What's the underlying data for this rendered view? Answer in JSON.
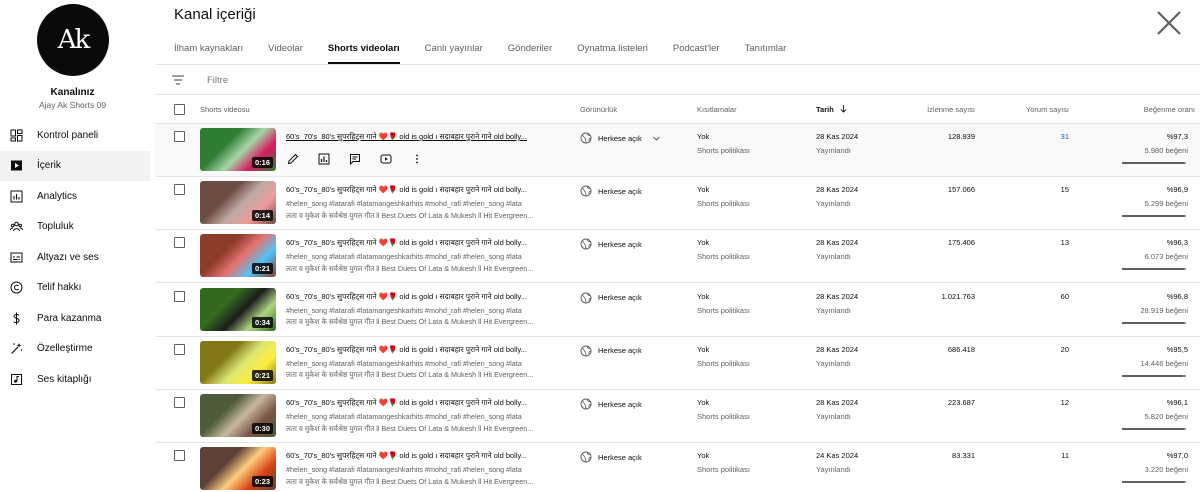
{
  "channel": {
    "avatar_text": "Ak",
    "title": "Kanalınız",
    "name": "Ajay Ak Shorts 09"
  },
  "nav": [
    {
      "label": "Kontrol paneli",
      "icon": "dashboard-icon"
    },
    {
      "label": "İçerik",
      "icon": "content-icon",
      "active": true
    },
    {
      "label": "Analytics",
      "icon": "analytics-icon"
    },
    {
      "label": "Topluluk",
      "icon": "community-icon"
    },
    {
      "label": "Altyazı ve ses",
      "icon": "subtitles-icon"
    },
    {
      "label": "Telif hakkı",
      "icon": "copyright-icon"
    },
    {
      "label": "Para kazanma",
      "icon": "monetization-icon"
    },
    {
      "label": "Özelleştirme",
      "icon": "customization-icon"
    },
    {
      "label": "Ses kitaplığı",
      "icon": "audio-library-icon"
    }
  ],
  "page_title": "Kanal içeriği",
  "tabs": [
    "İlham kaynakları",
    "Videolar",
    "Shorts videoları",
    "Canlı yayınlar",
    "Gönderiler",
    "Oynatma listeleri",
    "Podcast'ler",
    "Tanıtımlar"
  ],
  "active_tab": 2,
  "filter": {
    "placeholder": "Filtre"
  },
  "columns": {
    "video": "Shorts videosu",
    "visibility": "Görünürlük",
    "restrictions": "Kısıtlamalar",
    "date": "Tarih",
    "views": "İzlenme sayısı",
    "comments": "Yorum sayısı",
    "likes": "Beğenme oranı"
  },
  "rows": [
    {
      "title": "60's_70's_80's सुपरहिट्स गाने ❤️🌹 old is gold ı सदाबहार पुराने गाने old bolly...",
      "desc1": "#helen_song #latarafi #latamangeshkarhits #mohd_rafi #helen_song #lata",
      "desc2": "लता व मुकेश के सर्वश्रेष्ठ युगल गीत ll Best Duets Of Lata & Mukesh ll Hit Evergreen...",
      "duration": "0:16",
      "visibility": "Herkese açık",
      "restriction": "Yok",
      "restriction_sub": "Shorts politikası",
      "date": "28 Kas 2024",
      "date_sub": "Yayınlandı",
      "views": "128.939",
      "comments": "31",
      "like_pct": "%97,3",
      "like_count": "5.980 beğeni",
      "like_ratio": 0.973,
      "colors": [
        "#2e7d32",
        "#a5d6a7",
        "#d81b60"
      ]
    },
    {
      "title": "60's_70's_80's सुपरहिट्स गाने ❤️🌹 old is gold ı सदाबहार पुराने गाने old bolly...",
      "desc1": "#helen_song #latarafi #latamangeshkarhits #mohd_rafi #helen_song #lata",
      "desc2": "लता व मुकेश के सर्वश्रेष्ठ युगल गीत ll Best Duets Of Lata & Mukesh ll Hit Evergreen...",
      "duration": "0:14",
      "visibility": "Herkese açık",
      "restriction": "Yok",
      "restriction_sub": "Shorts politikası",
      "date": "28 Kas 2024",
      "date_sub": "Yayınlandı",
      "views": "157.066",
      "comments": "15",
      "like_pct": "%96,9",
      "like_count": "5.299 beğeni",
      "like_ratio": 0.969,
      "colors": [
        "#6d4c41",
        "#bcaaa4",
        "#ef9a9a"
      ]
    },
    {
      "title": "60's_70's_80's सुपरहिट्स गाने ❤️🌹 old is gold ı सदाबहार पुराने गाने old bolly...",
      "desc1": "#helen_song #latarafi #latamangeshkarhits #mohd_rafi #helen_song #lata",
      "desc2": "लता व मुकेश के सर्वश्रेष्ठ युगल गीत ll Best Duets Of Lata & Mukesh ll Hit Evergreen...",
      "duration": "0:21",
      "visibility": "Herkese açık",
      "restriction": "Yok",
      "restriction_sub": "Shorts politikası",
      "date": "28 Kas 2024",
      "date_sub": "Yayınlandı",
      "views": "175.406",
      "comments": "13",
      "like_pct": "%96,3",
      "like_count": "6.073 beğeni",
      "like_ratio": 0.963,
      "colors": [
        "#8d3b2a",
        "#e57373",
        "#4fc3f7"
      ]
    },
    {
      "title": "60's_70's_80's सुपरहिट्स गाने ❤️🌹 old is gold ı सदाबहार पुराने गाने old bolly...",
      "desc1": "#helen_song #latarafi #latamangeshkarhits #mohd_rafi #helen_song #lata",
      "desc2": "लता व मुकेश के सर्वश्रेष्ठ युगल गीत ll Best Duets Of Lata & Mukesh ll Hit Evergreen...",
      "duration": "0:34",
      "visibility": "Herkese açık",
      "restriction": "Yok",
      "restriction_sub": "Shorts politikası",
      "date": "28 Kas 2024",
      "date_sub": "Yayınlandı",
      "views": "1.021.763",
      "comments": "60",
      "like_pct": "%96,8",
      "like_count": "28.919 beğeni",
      "like_ratio": 0.968,
      "colors": [
        "#33691e",
        "#1b1b1b",
        "#aed581"
      ]
    },
    {
      "title": "60's_70's_80's सुपरहिट्स गाने ❤️🌹 old is gold ı सदाबहार पुराने गाने old bolly...",
      "desc1": "#helen_song #latarafi #latamangeshkarhits #mohd_rafi #helen_song #lata",
      "desc2": "लता व मुकेश के सर्वश्रेष्ठ युगल गीत ll Best Duets Of Lata & Mukesh ll Hit Evergreen...",
      "duration": "0:21",
      "visibility": "Herkese açık",
      "restriction": "Yok",
      "restriction_sub": "Shorts politikası",
      "date": "28 Kas 2024",
      "date_sub": "Yayınlandı",
      "views": "686.418",
      "comments": "20",
      "like_pct": "%95,5",
      "like_count": "14.446 beğeni",
      "like_ratio": 0.955,
      "colors": [
        "#827717",
        "#dce775",
        "#ffeb3b"
      ]
    },
    {
      "title": "60's_70's_80's सुपरहिट्स गाने ❤️🌹 old is gold ı सदाबहार पुराने गाने old bolly...",
      "desc1": "#helen_song #latarafi #latamangeshkarhits #mohd_rafi #helen_song #lata",
      "desc2": "लता व मुकेश के सर्वश्रेष्ठ युगल गीत ll Best Duets Of Lata & Mukesh ll Hit Evergreen...",
      "duration": "0:30",
      "visibility": "Herkese açık",
      "restriction": "Yok",
      "restriction_sub": "Shorts politikası",
      "date": "28 Kas 2024",
      "date_sub": "Yayınlandı",
      "views": "223.687",
      "comments": "12",
      "like_pct": "%96,1",
      "like_count": "5.820 beğeni",
      "like_ratio": 0.961,
      "colors": [
        "#4e5b3a",
        "#c8b8a0",
        "#795548"
      ]
    },
    {
      "title": "60's_70's_80's सुपरहिट्स गाने ❤️🌹 old is gold ı सदाबहार पुराने गाने old bolly...",
      "desc1": "#helen_song #latarafi #latamangeshkarhits #mohd_rafi #helen_song #lata",
      "desc2": "लता व मुकेश के सर्वश्रेष्ठ युगल गीत ll Best Duets Of Lata & Mukesh ll Hit Evergreen...",
      "duration": "0:23",
      "visibility": "Herkese açık",
      "restriction": "Yok",
      "restriction_sub": "Shorts politikası",
      "date": "24 Kas 2024",
      "date_sub": "Yayınlandı",
      "views": "83.331",
      "comments": "11",
      "like_pct": "%97,0",
      "like_count": "3.220 beğeni",
      "like_ratio": 0.97,
      "colors": [
        "#5d4037",
        "#ffcc80",
        "#d84315"
      ]
    }
  ]
}
